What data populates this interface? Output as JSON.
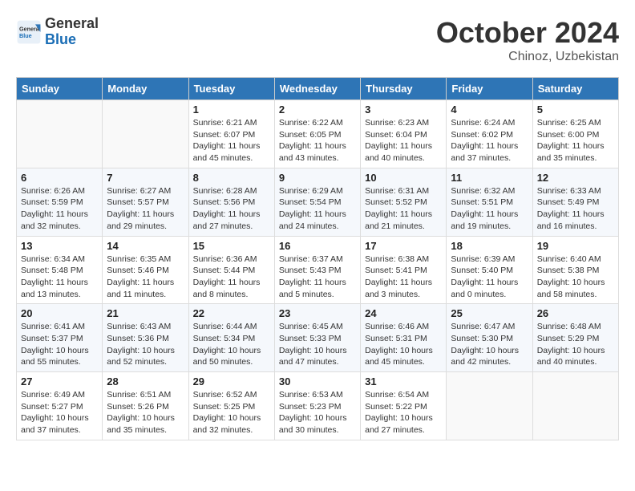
{
  "header": {
    "logo_line1": "General",
    "logo_line2": "Blue",
    "month": "October 2024",
    "location": "Chinoz, Uzbekistan"
  },
  "columns": [
    "Sunday",
    "Monday",
    "Tuesday",
    "Wednesday",
    "Thursday",
    "Friday",
    "Saturday"
  ],
  "weeks": [
    [
      {
        "day": "",
        "info": ""
      },
      {
        "day": "",
        "info": ""
      },
      {
        "day": "1",
        "info": "Sunrise: 6:21 AM\nSunset: 6:07 PM\nDaylight: 11 hours and 45 minutes."
      },
      {
        "day": "2",
        "info": "Sunrise: 6:22 AM\nSunset: 6:05 PM\nDaylight: 11 hours and 43 minutes."
      },
      {
        "day": "3",
        "info": "Sunrise: 6:23 AM\nSunset: 6:04 PM\nDaylight: 11 hours and 40 minutes."
      },
      {
        "day": "4",
        "info": "Sunrise: 6:24 AM\nSunset: 6:02 PM\nDaylight: 11 hours and 37 minutes."
      },
      {
        "day": "5",
        "info": "Sunrise: 6:25 AM\nSunset: 6:00 PM\nDaylight: 11 hours and 35 minutes."
      }
    ],
    [
      {
        "day": "6",
        "info": "Sunrise: 6:26 AM\nSunset: 5:59 PM\nDaylight: 11 hours and 32 minutes."
      },
      {
        "day": "7",
        "info": "Sunrise: 6:27 AM\nSunset: 5:57 PM\nDaylight: 11 hours and 29 minutes."
      },
      {
        "day": "8",
        "info": "Sunrise: 6:28 AM\nSunset: 5:56 PM\nDaylight: 11 hours and 27 minutes."
      },
      {
        "day": "9",
        "info": "Sunrise: 6:29 AM\nSunset: 5:54 PM\nDaylight: 11 hours and 24 minutes."
      },
      {
        "day": "10",
        "info": "Sunrise: 6:31 AM\nSunset: 5:52 PM\nDaylight: 11 hours and 21 minutes."
      },
      {
        "day": "11",
        "info": "Sunrise: 6:32 AM\nSunset: 5:51 PM\nDaylight: 11 hours and 19 minutes."
      },
      {
        "day": "12",
        "info": "Sunrise: 6:33 AM\nSunset: 5:49 PM\nDaylight: 11 hours and 16 minutes."
      }
    ],
    [
      {
        "day": "13",
        "info": "Sunrise: 6:34 AM\nSunset: 5:48 PM\nDaylight: 11 hours and 13 minutes."
      },
      {
        "day": "14",
        "info": "Sunrise: 6:35 AM\nSunset: 5:46 PM\nDaylight: 11 hours and 11 minutes."
      },
      {
        "day": "15",
        "info": "Sunrise: 6:36 AM\nSunset: 5:44 PM\nDaylight: 11 hours and 8 minutes."
      },
      {
        "day": "16",
        "info": "Sunrise: 6:37 AM\nSunset: 5:43 PM\nDaylight: 11 hours and 5 minutes."
      },
      {
        "day": "17",
        "info": "Sunrise: 6:38 AM\nSunset: 5:41 PM\nDaylight: 11 hours and 3 minutes."
      },
      {
        "day": "18",
        "info": "Sunrise: 6:39 AM\nSunset: 5:40 PM\nDaylight: 11 hours and 0 minutes."
      },
      {
        "day": "19",
        "info": "Sunrise: 6:40 AM\nSunset: 5:38 PM\nDaylight: 10 hours and 58 minutes."
      }
    ],
    [
      {
        "day": "20",
        "info": "Sunrise: 6:41 AM\nSunset: 5:37 PM\nDaylight: 10 hours and 55 minutes."
      },
      {
        "day": "21",
        "info": "Sunrise: 6:43 AM\nSunset: 5:36 PM\nDaylight: 10 hours and 52 minutes."
      },
      {
        "day": "22",
        "info": "Sunrise: 6:44 AM\nSunset: 5:34 PM\nDaylight: 10 hours and 50 minutes."
      },
      {
        "day": "23",
        "info": "Sunrise: 6:45 AM\nSunset: 5:33 PM\nDaylight: 10 hours and 47 minutes."
      },
      {
        "day": "24",
        "info": "Sunrise: 6:46 AM\nSunset: 5:31 PM\nDaylight: 10 hours and 45 minutes."
      },
      {
        "day": "25",
        "info": "Sunrise: 6:47 AM\nSunset: 5:30 PM\nDaylight: 10 hours and 42 minutes."
      },
      {
        "day": "26",
        "info": "Sunrise: 6:48 AM\nSunset: 5:29 PM\nDaylight: 10 hours and 40 minutes."
      }
    ],
    [
      {
        "day": "27",
        "info": "Sunrise: 6:49 AM\nSunset: 5:27 PM\nDaylight: 10 hours and 37 minutes."
      },
      {
        "day": "28",
        "info": "Sunrise: 6:51 AM\nSunset: 5:26 PM\nDaylight: 10 hours and 35 minutes."
      },
      {
        "day": "29",
        "info": "Sunrise: 6:52 AM\nSunset: 5:25 PM\nDaylight: 10 hours and 32 minutes."
      },
      {
        "day": "30",
        "info": "Sunrise: 6:53 AM\nSunset: 5:23 PM\nDaylight: 10 hours and 30 minutes."
      },
      {
        "day": "31",
        "info": "Sunrise: 6:54 AM\nSunset: 5:22 PM\nDaylight: 10 hours and 27 minutes."
      },
      {
        "day": "",
        "info": ""
      },
      {
        "day": "",
        "info": ""
      }
    ]
  ]
}
